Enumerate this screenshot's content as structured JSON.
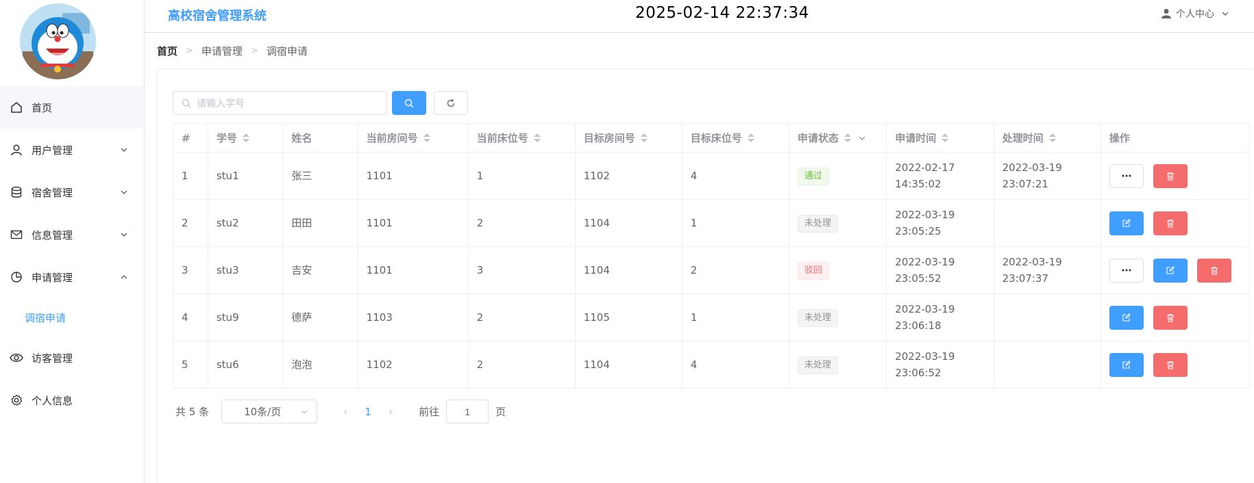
{
  "header": {
    "brand": "高校宿舍管理系统",
    "clock": "2025-02-14 22:37:34",
    "user_center": "个人中心"
  },
  "sidebar": {
    "items": [
      {
        "label": "首页",
        "icon": "home-icon",
        "active": true
      },
      {
        "label": "用户管理",
        "icon": "user-icon",
        "expanded": false
      },
      {
        "label": "宿舍管理",
        "icon": "database-icon",
        "expanded": false
      },
      {
        "label": "信息管理",
        "icon": "mail-icon",
        "expanded": false
      },
      {
        "label": "申请管理",
        "icon": "pie-chart-icon",
        "expanded": true
      },
      {
        "label": "访客管理",
        "icon": "eye-icon"
      },
      {
        "label": "个人信息",
        "icon": "gear-icon"
      }
    ],
    "submenu": {
      "label": "调宿申请"
    }
  },
  "breadcrumb": [
    "首页",
    "申请管理",
    "调宿申请"
  ],
  "search": {
    "placeholder": "请输入学号"
  },
  "table": {
    "headers": [
      "#",
      "学号",
      "姓名",
      "当前房间号",
      "当前床位号",
      "目标房间号",
      "目标床位号",
      "申请状态",
      "申请时间",
      "处理时间",
      "操作"
    ],
    "rows": [
      {
        "idx": "1",
        "sid": "stu1",
        "name": "张三",
        "cur_room": "1101",
        "cur_bed": "1",
        "tgt_room": "1102",
        "tgt_bed": "4",
        "status": "通过",
        "apply_time": "2022-02-17 14:35:02",
        "process_time": "2022-03-19 23:07:21"
      },
      {
        "idx": "2",
        "sid": "stu2",
        "name": "田田",
        "cur_room": "1101",
        "cur_bed": "2",
        "tgt_room": "1104",
        "tgt_bed": "1",
        "status": "未处理",
        "apply_time": "2022-03-19 23:05:25",
        "process_time": ""
      },
      {
        "idx": "3",
        "sid": "stu3",
        "name": "吉安",
        "cur_room": "1101",
        "cur_bed": "3",
        "tgt_room": "1104",
        "tgt_bed": "2",
        "status": "驳回",
        "apply_time": "2022-03-19 23:05:52",
        "process_time": "2022-03-19 23:07:37"
      },
      {
        "idx": "4",
        "sid": "stu9",
        "name": "德萨",
        "cur_room": "1103",
        "cur_bed": "2",
        "tgt_room": "1105",
        "tgt_bed": "1",
        "status": "未处理",
        "apply_time": "2022-03-19 23:06:18",
        "process_time": ""
      },
      {
        "idx": "5",
        "sid": "stu6",
        "name": "泡泡",
        "cur_room": "1102",
        "cur_bed": "2",
        "tgt_room": "1104",
        "tgt_bed": "4",
        "status": "未处理",
        "apply_time": "2022-03-19 23:06:52",
        "process_time": ""
      }
    ]
  },
  "pagination": {
    "total": "共 5 条",
    "page_size": "10条/页",
    "current_page": "1",
    "goto_label": "前往",
    "goto_value": "1",
    "page_unit": "页"
  },
  "colors": {
    "primary": "#409eff",
    "danger": "#f56c6c",
    "success": "#67c23a",
    "info": "#909399"
  }
}
